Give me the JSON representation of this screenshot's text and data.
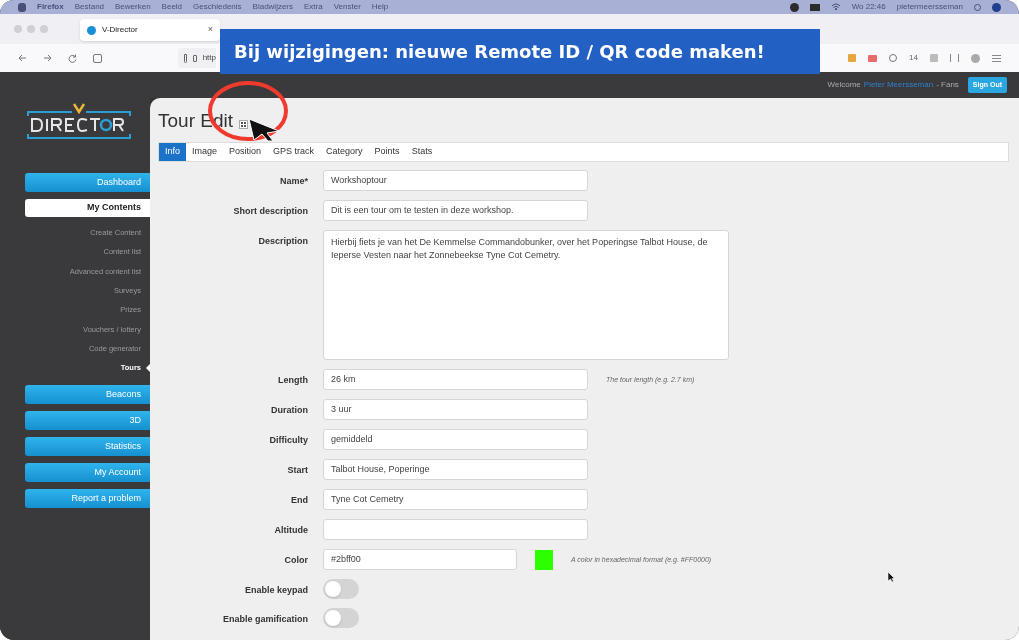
{
  "menubar": {
    "app": "Firefox",
    "menus": [
      "Bestand",
      "Bewerken",
      "Beeld",
      "Geschiedenis",
      "Bladwijzers",
      "Extra",
      "Venster",
      "Help"
    ],
    "clock": "Wo 22:46",
    "user": "pietermeersseman"
  },
  "browser": {
    "tab_title": "V-Director",
    "tab_close": "×",
    "url": "http",
    "toolbar_badge": "14"
  },
  "banner": "Bij wijzigingen: nieuwe Remote ID / QR code maken!",
  "header": {
    "welcome": "Welcome",
    "user_name": "Pieter Meersseman",
    "role": "- Fans",
    "sign_out": "Sign Out"
  },
  "sidebar": {
    "items": [
      {
        "kind": "button",
        "label": "Dashboard"
      },
      {
        "kind": "group",
        "label": "My Contents",
        "children": [
          {
            "label": "Create Content",
            "selected": false
          },
          {
            "label": "Content list",
            "selected": false
          },
          {
            "label": "Advanced content list",
            "selected": false
          },
          {
            "label": "Surveys",
            "selected": false
          },
          {
            "label": "Prizes",
            "selected": false
          },
          {
            "label": "Vouchers / lottery",
            "selected": false
          },
          {
            "label": "Code generator",
            "selected": false
          },
          {
            "label": "Tours",
            "selected": true
          }
        ]
      },
      {
        "kind": "button",
        "label": "Beacons"
      },
      {
        "kind": "button",
        "label": "3D"
      },
      {
        "kind": "button",
        "label": "Statistics"
      },
      {
        "kind": "button",
        "label": "My Account"
      },
      {
        "kind": "button",
        "label": "Report a problem"
      }
    ]
  },
  "page": {
    "title": "Tour Edit",
    "tabs": [
      {
        "label": "Info",
        "selected": true
      },
      {
        "label": "Image",
        "selected": false
      },
      {
        "label": "Position",
        "selected": false
      },
      {
        "label": "GPS track",
        "selected": false
      },
      {
        "label": "Category",
        "selected": false
      },
      {
        "label": "Points",
        "selected": false
      },
      {
        "label": "Stats",
        "selected": false
      }
    ],
    "fields": [
      {
        "kind": "text",
        "label": "Name*",
        "value": "Workshoptour"
      },
      {
        "kind": "text",
        "label": "Short description",
        "value": "Dit is een tour om te testen in deze workshop."
      },
      {
        "kind": "textarea",
        "label": "Description",
        "value": "Hierbij fiets je van het De Kemmelse Commandobunker, over het Poperingse Talbot House, de Ieperse Vesten naar het Zonnebeekse Tyne Cot Cemetry."
      },
      {
        "kind": "text",
        "label": "Length",
        "value": "26 km",
        "hint": "The tour length (e.g. 2.7 km)"
      },
      {
        "kind": "text",
        "label": "Duration",
        "value": "3 uur"
      },
      {
        "kind": "text",
        "label": "Difficulty",
        "value": "gemiddeld"
      },
      {
        "kind": "text",
        "label": "Start",
        "value": "Talbot House, Poperinge"
      },
      {
        "kind": "text",
        "label": "End",
        "value": "Tyne Cot Cemetry"
      },
      {
        "kind": "text",
        "label": "Altitude"
      },
      {
        "kind": "color",
        "label": "Color",
        "value": "#2bff00",
        "color": "#2bff00",
        "hint": "A color in hexadecimal format (e.g. #FF0000)"
      },
      {
        "kind": "toggle",
        "label": "Enable keypad",
        "on": false
      },
      {
        "kind": "toggle",
        "label": "Enable gamification",
        "on": false
      }
    ]
  }
}
